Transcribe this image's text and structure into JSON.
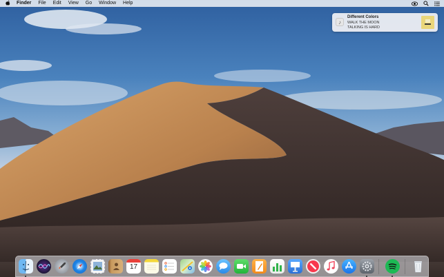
{
  "menubar": {
    "apple_icon": "apple-icon",
    "items": [
      "Finder",
      "File",
      "Edit",
      "View",
      "Go",
      "Window",
      "Help"
    ],
    "right_icons": [
      "eye-icon",
      "search-icon",
      "list-icon"
    ]
  },
  "notification": {
    "app_icon": "music-note-icon",
    "title": "Different Colors",
    "artist": "WALK THE MOON",
    "album": "TALKING IS HARD"
  },
  "dock": {
    "items": [
      {
        "name": "finder",
        "icon": "finder-icon",
        "running": true
      },
      {
        "name": "siri",
        "icon": "siri-icon",
        "running": false
      },
      {
        "name": "launchpad",
        "icon": "rocket-icon",
        "running": false
      },
      {
        "name": "safari",
        "icon": "compass-icon",
        "running": false
      },
      {
        "name": "mail",
        "icon": "stamp-icon",
        "running": false
      },
      {
        "name": "contacts",
        "icon": "contacts-book-icon",
        "running": false
      },
      {
        "name": "calendar",
        "icon": "calendar-icon",
        "running": false,
        "day": "17"
      },
      {
        "name": "notes",
        "icon": "notes-icon",
        "running": false
      },
      {
        "name": "reminders",
        "icon": "checklist-icon",
        "running": false
      },
      {
        "name": "maps",
        "icon": "map-icon",
        "running": false
      },
      {
        "name": "photos",
        "icon": "photos-flower-icon",
        "running": false
      },
      {
        "name": "messages",
        "icon": "chat-bubble-icon",
        "running": false
      },
      {
        "name": "facetime",
        "icon": "video-camera-icon",
        "running": false
      },
      {
        "name": "pages",
        "icon": "pages-icon",
        "running": false
      },
      {
        "name": "numbers",
        "icon": "bar-chart-icon",
        "running": false
      },
      {
        "name": "keynote",
        "icon": "podium-icon",
        "running": false
      },
      {
        "name": "news",
        "icon": "news-icon",
        "running": false
      },
      {
        "name": "music",
        "icon": "music-note-icon",
        "running": false
      },
      {
        "name": "app-store",
        "icon": "app-store-icon",
        "running": false
      },
      {
        "name": "system-preferences",
        "icon": "gear-icon",
        "running": true
      },
      {
        "name": "spotify",
        "icon": "spotify-icon",
        "running": true
      },
      {
        "name": "trash",
        "icon": "trash-icon",
        "running": false
      }
    ]
  },
  "colors": {
    "menubar_bg": "#ebeef3",
    "notification_bg": "#eceef2",
    "sky_top": "#2e5f9f",
    "dune": "#c7925a",
    "spotify_green": "#1db954"
  }
}
